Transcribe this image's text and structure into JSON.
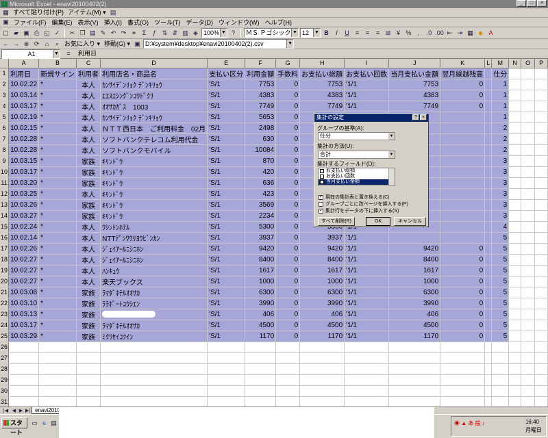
{
  "window": {
    "title": "Microsoft Excel - enavi20100402(2)"
  },
  "links_bar": {
    "items": [
      "すべて貼り付け(P)",
      "アイテム(M) ▾"
    ]
  },
  "menu": [
    "ファイル(F)",
    "編集(E)",
    "表示(V)",
    "挿入(I)",
    "書式(O)",
    "ツール(T)",
    "データ(D)",
    "ウィンドウ(W)",
    "ヘルプ(H)"
  ],
  "toolbar": {
    "zoom": "100%",
    "font": "ＭＳ Ｐゴシック",
    "size": "12",
    "bold": "B",
    "italic": "I",
    "underline": "U"
  },
  "web_bar": {
    "favorites": "お気に入り ▾",
    "goto": "移動(G) ▾",
    "path": "D:¥system¥desktop¥enavi20100402(2).csv"
  },
  "formula_bar": {
    "cell_ref": "A1",
    "equals": "=",
    "value": "利用日"
  },
  "columns": [
    "A",
    "B",
    "C",
    "D",
    "E",
    "F",
    "G",
    "H",
    "I",
    "J",
    "K",
    "L",
    "M",
    "N",
    "O",
    "P"
  ],
  "header_row": [
    "利用日",
    "新規サイン",
    "利用者",
    "利用店名・商品名",
    "支払い区分",
    "利用金額",
    "手数料",
    "お支払い総額",
    "お支払い回数",
    "当月支払い金額",
    "翌月繰越残高",
    "",
    "仕分"
  ],
  "rows": [
    [
      "10.02.22",
      "*",
      "本人",
      "ｶﾝｻｲﾃﾞﾝﾘｮｸ ﾃﾞﾝｷﾘｮｳ",
      "'S/1",
      "7753",
      "0",
      "7753",
      "'1/1",
      "7753",
      "0",
      "",
      "1"
    ],
    [
      "10.03.14",
      "*",
      "本人",
      "ｴｴｽｴｼﾝｸﾞﾝｺｳﾄﾞｸﾘ",
      "'S/1",
      "4383",
      "0",
      "4383",
      "'1/1",
      "4383",
      "0",
      "",
      "1"
    ],
    [
      "10.03.17",
      "*",
      "本人",
      "ｵｵｻｶｶﾞｽ　1003",
      "'S/1",
      "7749",
      "0",
      "7749",
      "'1/1",
      "7749",
      "0",
      "",
      "1"
    ],
    [
      "10.02.19",
      "*",
      "本人",
      "ｶﾝｻｲﾃﾞﾝﾘｮｸ ﾃﾞﾝｷﾘｮｳ",
      "'S/1",
      "5653",
      "0",
      "5653",
      "'1/1",
      "",
      "",
      "",
      "1"
    ],
    [
      "10.02.15",
      "*",
      "本人",
      "ＮＴＴ西日本　ご利用料金　02月",
      "'S/1",
      "2498",
      "0",
      "2498",
      "'1/1",
      "",
      "",
      "",
      "2"
    ],
    [
      "10.02.28",
      "*",
      "本人",
      "ソフトバンクテレコム利用代金",
      "'S/1",
      "630",
      "0",
      "630",
      "'1/1",
      "",
      "",
      "",
      "2"
    ],
    [
      "10.02.28",
      "*",
      "本人",
      "ソフトバンクモバイル",
      "'S/1",
      "10084",
      "0",
      "10084",
      "'1/1",
      "",
      "",
      "",
      "2"
    ],
    [
      "10.03.15",
      "*",
      "家族",
      "ｷﾘﾝﾄﾞｳ",
      "'S/1",
      "870",
      "0",
      "870",
      "'1/1",
      "",
      "",
      "",
      "3"
    ],
    [
      "10.03.17",
      "*",
      "家族",
      "ｷﾘﾝﾄﾞｳ",
      "'S/1",
      "420",
      "0",
      "420",
      "'1/1",
      "",
      "",
      "",
      "3"
    ],
    [
      "10.03.20",
      "*",
      "家族",
      "ｷﾘﾝﾄﾞｳ",
      "'S/1",
      "636",
      "0",
      "636",
      "'1/1",
      "",
      "",
      "",
      "3"
    ],
    [
      "10.03.25",
      "*",
      "本人",
      "ｷﾘﾝﾄﾞｳ",
      "'S/1",
      "423",
      "0",
      "423",
      "'1/1",
      "",
      "",
      "",
      "3"
    ],
    [
      "10.03.26",
      "*",
      "家族",
      "ｷﾘﾝﾄﾞｳ",
      "'S/1",
      "3569",
      "0",
      "3569",
      "'1/1",
      "",
      "",
      "",
      "3"
    ],
    [
      "10.03.27",
      "*",
      "家族",
      "ｷﾘﾝﾄﾞｳ",
      "'S/1",
      "2234",
      "0",
      "2234",
      "'1/1",
      "",
      "",
      "",
      "3"
    ],
    [
      "10.02.24",
      "*",
      "本人",
      "ﾜｼﾝﾄﾝﾎﾃﾙ",
      "'S/1",
      "5300",
      "0",
      "5300",
      "'1/1",
      "",
      "",
      "",
      "4"
    ],
    [
      "10.02.14",
      "*",
      "本人",
      "NTTﾃﾞﾝﾜｳﾘﾖｳﾋﾞﾝｶﾝ",
      "'S/1",
      "3937",
      "0",
      "3937",
      "'1/1",
      "",
      "",
      "",
      "5"
    ],
    [
      "10.02.26",
      "*",
      "本人",
      "ｼﾞｪｲｱｰﾙﾆｼﾆﾎﾝ",
      "'S/1",
      "9420",
      "0",
      "9420",
      "'1/1",
      "9420",
      "0",
      "",
      "5"
    ],
    [
      "10.02.27",
      "*",
      "本人",
      "ｼﾞｪｲｱｰﾙﾆｼﾆﾎﾝ",
      "'S/1",
      "8400",
      "0",
      "8400",
      "'1/1",
      "8400",
      "0",
      "",
      "5"
    ],
    [
      "10.02.27",
      "*",
      "本人",
      "ﾊﾝｷｭｳ",
      "'S/1",
      "1617",
      "0",
      "1617",
      "'1/1",
      "1617",
      "0",
      "",
      "5"
    ],
    [
      "10.02.27",
      "*",
      "本人",
      "楽天ブックス",
      "'S/1",
      "1000",
      "0",
      "1000",
      "'1/1",
      "1000",
      "0",
      "",
      "5"
    ],
    [
      "10.03.08",
      "*",
      "家族",
      "ﾗﾏﾀﾞﾎﾃﾙｵｵｻｶ",
      "'S/1",
      "6300",
      "0",
      "6300",
      "'1/1",
      "6300",
      "0",
      "",
      "5"
    ],
    [
      "10.03.10",
      "*",
      "家族",
      "ﾗﾗﾎﾟｰﾄｺｳｼｴﾝ",
      "'S/1",
      "3990",
      "0",
      "3990",
      "'1/1",
      "3990",
      "0",
      "",
      "5"
    ],
    [
      "10.03.13",
      "*",
      "家族",
      "",
      "'S/1",
      "406",
      "0",
      "406",
      "'1/1",
      "406",
      "0",
      "",
      "5"
    ],
    [
      "10.03.17",
      "*",
      "家族",
      "ﾗﾏﾀﾞﾎﾃﾙｵｵｻｶ",
      "'S/1",
      "4500",
      "0",
      "4500",
      "'1/1",
      "4500",
      "0",
      "",
      "5"
    ],
    [
      "10.03.29",
      "*",
      "家族",
      "ﾐｸﾜｾｲｺﾂｲﾝ",
      "'S/1",
      "1170",
      "0",
      "1170",
      "'1/1",
      "1170",
      "0",
      "",
      "5"
    ]
  ],
  "empty_rows": [
    "26",
    "27",
    "28",
    "29",
    "30",
    "31",
    "32",
    "33",
    "34",
    "35"
  ],
  "dialog": {
    "title": "集計の設定",
    "group_label": "グループの基準(A):",
    "group_value": "仕分",
    "func_label": "集計の方法(U):",
    "func_value": "合計",
    "fields_label": "集計するフィールド(D):",
    "fields": [
      "お支払い総額",
      "お支払い回数",
      "当月支払い金額"
    ],
    "opt1": "現在の集計表と置き換える(C)",
    "opt2": "グループごとに改ページを挿入する(P)",
    "opt3": "集計行をデータの下に挿入する(S)",
    "btn_remove": "すべて削除(R)",
    "btn_ok": "OK",
    "btn_cancel": "キャンセル"
  },
  "sheet_tab": "enavi2010040",
  "taskbar": {
    "start": "スタート",
    "clock": "16:40",
    "day": "月曜日"
  }
}
